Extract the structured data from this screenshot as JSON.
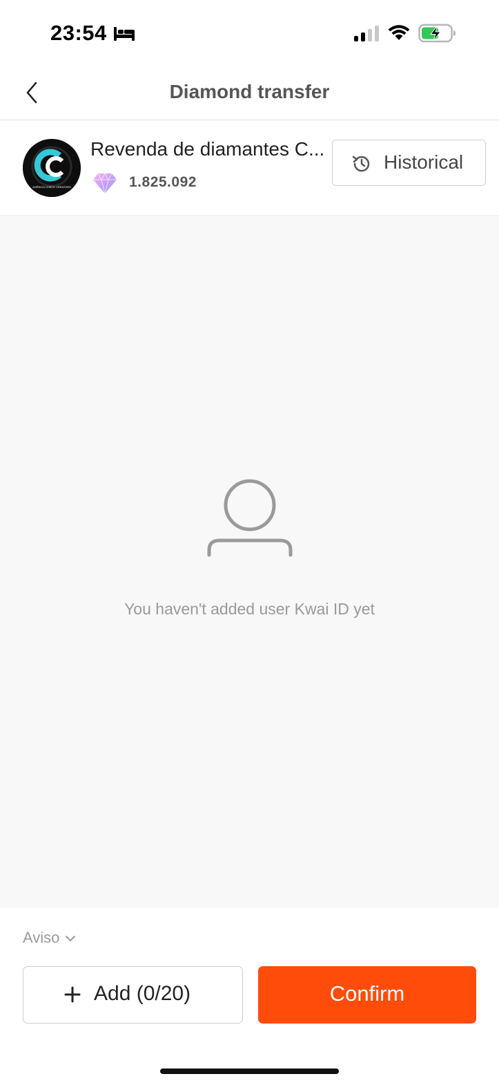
{
  "status_bar": {
    "time": "23:54",
    "icons": [
      "bed-icon",
      "cellular-signal-icon",
      "wifi-icon",
      "battery-charging-icon"
    ],
    "battery_color": "#34c759"
  },
  "nav": {
    "title": "Diamond transfer",
    "back_icon": "chevron-left-icon"
  },
  "account": {
    "name": "Revenda de diamantes C...",
    "balance": "1.825.092",
    "avatar_icon": "agency-logo",
    "avatar_text": "AGÊNCIA CHECK CREATORS",
    "currency_icon": "diamond-icon",
    "historical_label": "Historical",
    "historical_icon": "history-clock-icon"
  },
  "empty_state": {
    "icon": "user-outline-icon",
    "message": "You haven't added user Kwai ID yet"
  },
  "footer": {
    "aviso_label": "Aviso",
    "add_label": "Add (0/20)",
    "confirm_label": "Confirm",
    "accent_color": "#ff4c0a"
  }
}
